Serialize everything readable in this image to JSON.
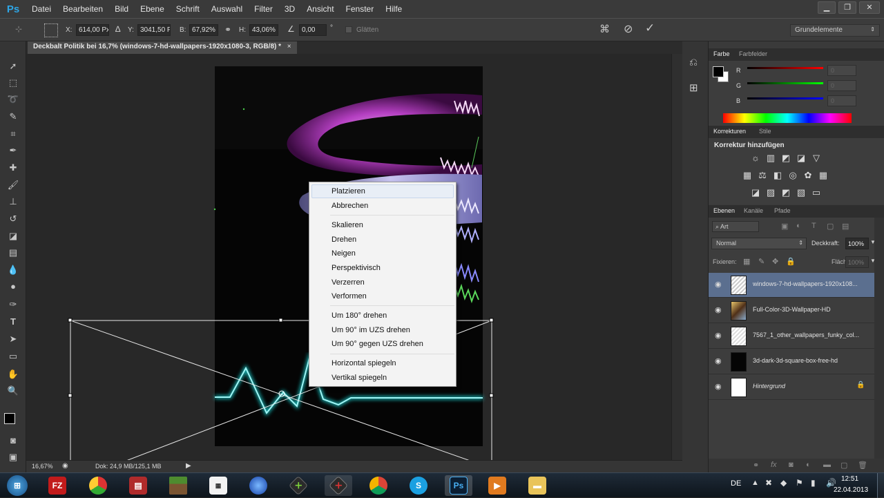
{
  "app": {
    "logo": "Ps",
    "menu": [
      "Datei",
      "Bearbeiten",
      "Bild",
      "Ebene",
      "Schrift",
      "Auswahl",
      "Filter",
      "3D",
      "Ansicht",
      "Fenster",
      "Hilfe"
    ]
  },
  "options": {
    "x_label": "X:",
    "x_value": "614,00 Px",
    "y_label": "Y:",
    "y_value": "3041,50 P",
    "w_label": "B:",
    "w_value": "67,92%",
    "h_label": "H:",
    "h_value": "43,06%",
    "angle_value": "0,00",
    "angle_unit": "°",
    "smooth_label": "Glätten",
    "workspace": "Grundelemente"
  },
  "document": {
    "tab_title": "Deckbalt Politik bei 16,7% (windows-7-hd-wallpapers-1920x1080-3, RGB/8) *",
    "tab_close": "×",
    "zoom": "16,67%",
    "doc_info": "Dok: 24,9 MB/125,1 MB"
  },
  "context_menu": {
    "items": [
      "Platzieren",
      "Abbrechen",
      "Skalieren",
      "Drehen",
      "Neigen",
      "Perspektivisch",
      "Verzerren",
      "Verformen",
      "Um 180° drehen",
      "Um 90° im UZS drehen",
      "Um 90° gegen UZS drehen",
      "Horizontal spiegeln",
      "Vertikal spiegeln"
    ]
  },
  "color_panel": {
    "tabs": [
      "Farbe",
      "Farbfelder"
    ],
    "r_label": "R",
    "g_label": "G",
    "b_label": "B",
    "r_value": "0",
    "g_value": "0",
    "b_value": "0"
  },
  "adjust_panel": {
    "tabs": [
      "Korrekturen",
      "Stile"
    ],
    "heading": "Korrektur hinzufügen"
  },
  "layers_panel": {
    "tabs": [
      "Ebenen",
      "Kanäle",
      "Pfade"
    ],
    "filter": "Art",
    "blend_mode": "Normal",
    "opacity_label": "Deckkraft:",
    "opacity_value": "100%",
    "lock_label": "Fixieren:",
    "fill_label": "Fläche:",
    "fill_value": "100%",
    "layers": [
      {
        "name": "windows-7-hd-wallpapers-1920x108...",
        "selected": true
      },
      {
        "name": "Full-Color-3D-Wallpaper-HD",
        "selected": false
      },
      {
        "name": "7567_1_other_wallpapers_funky_col...",
        "selected": false
      },
      {
        "name": "3d-dark-3d-square-box-free-hd",
        "selected": false
      },
      {
        "name": "Hintergrund",
        "selected": false
      }
    ]
  },
  "taskbar": {
    "lang": "DE",
    "time": "12:51",
    "date": "22.04.2013",
    "apps": [
      "Start",
      "FileZilla",
      "Chrome-alt",
      "Media",
      "Minecraft",
      "Notes",
      "Globe",
      "Xbox",
      "Xbox-alt",
      "Chrome",
      "Skype",
      "Photoshop",
      "Video",
      "Explorer"
    ],
    "app_labels": [
      "",
      "FZ",
      "",
      "",
      "",
      "",
      "",
      "",
      "",
      "",
      "S",
      "Ps",
      "",
      ""
    ]
  }
}
